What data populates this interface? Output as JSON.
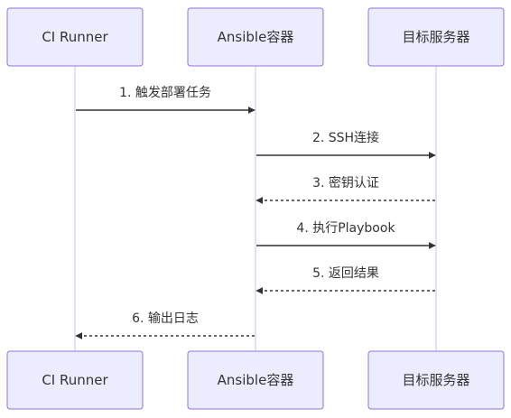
{
  "participants": [
    {
      "id": "ci",
      "label": "CI Runner"
    },
    {
      "id": "ansible",
      "label": "Ansible容器"
    },
    {
      "id": "target",
      "label": "目标服务器"
    }
  ],
  "messages": [
    {
      "from": "ci",
      "to": "ansible",
      "label": "1. 触发部署任务",
      "style": "solid"
    },
    {
      "from": "ansible",
      "to": "target",
      "label": "2. SSH连接",
      "style": "solid"
    },
    {
      "from": "target",
      "to": "ansible",
      "label": "3. 密钥认证",
      "style": "dotted"
    },
    {
      "from": "ansible",
      "to": "target",
      "label": "4. 执行Playbook",
      "style": "solid"
    },
    {
      "from": "target",
      "to": "ansible",
      "label": "5. 返回结果",
      "style": "dotted"
    },
    {
      "from": "ansible",
      "to": "ci",
      "label": "6. 输出日志",
      "style": "dotted"
    }
  ],
  "colors": {
    "actor_fill": "#ececff",
    "actor_border": "#9370db",
    "line": "#333333",
    "text": "#333333"
  }
}
